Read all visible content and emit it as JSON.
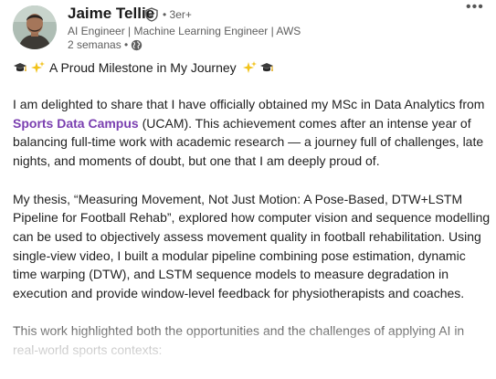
{
  "author": {
    "name": "Jaime Tellie",
    "degree": "• 3er+",
    "headline": "AI Engineer | Machine Learning Engineer | AWS",
    "time": "2 semanas •",
    "avatar_icon": "person-photo",
    "verified_icon": "shield-check-icon",
    "visibility_icon": "globe-icon"
  },
  "menu": {
    "more_label": "•••"
  },
  "post": {
    "title": "A Proud Milestone in My Journey",
    "title_emojis": [
      "graduation-cap",
      "sparkles",
      "sparkles",
      "graduation-cap"
    ],
    "p1_before": "I am delighted to share that I have officially obtained my MSc in Data Analytics from ",
    "p1_org": "Sports Data Campus",
    "p1_after": " (UCAM). This achievement comes after an intense year of balancing full-time work with academic research — a journey full of challenges, late nights, and moments of doubt, but one that I am deeply proud of.",
    "p2": "My thesis, “Measuring Movement, Not Just Motion: A Pose-Based, DTW+LSTM Pipeline for Football Rehab”, explored how computer vision and sequence modelling can be used to objectively assess movement quality in football rehabilitation. Using single-view video, I built a modular pipeline combining pose estimation, dynamic time warping (DTW), and LSTM sequence models to measure degradation in execution and provide window-level feedback for physiotherapists and coaches.",
    "p3": "This work highlighted both the opportunities and the challenges of applying AI in real-world sports contexts:"
  },
  "colors": {
    "link": "#7a3fb0",
    "muted": "#5e5e5e",
    "text": "#1f1f1f"
  }
}
